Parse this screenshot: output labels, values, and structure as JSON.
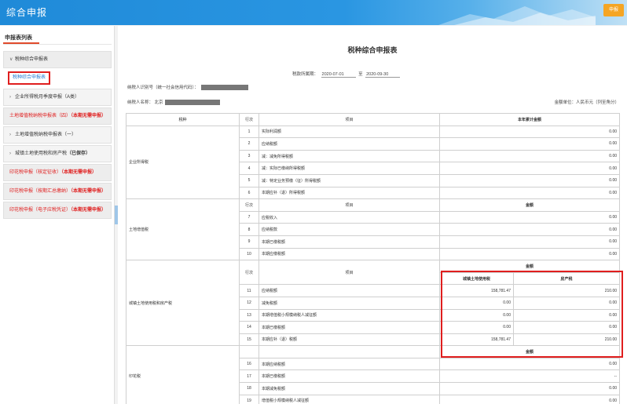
{
  "header": {
    "title": "综合申报",
    "declare_button": "申报"
  },
  "sidebar": {
    "tab_title": "申报表列表",
    "items": [
      {
        "label": "税种综合申报表",
        "chevron": "∨",
        "kind": "group"
      },
      {
        "label": "税种综合申报表",
        "kind": "selected-sub"
      },
      {
        "label": "企业所得税月季度申报（A类）",
        "chevron": "›",
        "kind": "group"
      },
      {
        "label": "土地增值税纳税申报表（四）",
        "suffix": "（本期无需申报）",
        "kind": "red"
      },
      {
        "label": "土地增值税纳税申报表（一）",
        "chevron": "›",
        "kind": "group"
      },
      {
        "label": "城镇土地使用税和房产税",
        "suffix": "（已保存）",
        "chevron": "›",
        "kind": "group-saved"
      },
      {
        "label": "印花税申报（核定征收）",
        "suffix": "（本期无需申报）",
        "kind": "red"
      },
      {
        "label": "印花税申报（按期汇总缴纳）",
        "suffix": "（本期无需申报）",
        "kind": "red"
      },
      {
        "label": "印花税申报（电子应税凭证）",
        "suffix": "（本期无需申报）",
        "kind": "red"
      }
    ]
  },
  "form": {
    "title": "税种综合申报表",
    "period_label": "税款所属期：",
    "period_start": "2020-07-01",
    "period_to": "至",
    "period_end": "2020-09-30",
    "taxid_label": "纳税人识别号（统一社会信用代码）：",
    "taxname_label": "纳税人名称：",
    "taxname_prefix": "北京",
    "unit_label": "金额单位：人民币元（列至角分）",
    "headers": {
      "tax_type": "税种",
      "line_no": "行次",
      "item": "项目",
      "ytd": "本年累计金额",
      "amount": "金额",
      "land_use": "城镇土地使用税",
      "property": "房产税"
    },
    "sections": {
      "cit": {
        "name": "企业所得税",
        "rows": [
          {
            "no": "1",
            "item": "实际利润额",
            "value": "0.00"
          },
          {
            "no": "2",
            "item": "应纳税额",
            "value": "0.00"
          },
          {
            "no": "3",
            "item": "减：减免所得税额",
            "value": "0.00"
          },
          {
            "no": "4",
            "item": "减：实际已缴纳所得税额",
            "value": "0.00"
          },
          {
            "no": "5",
            "item": "减：特定业务预缴（征）所得税额",
            "value": "0.00"
          },
          {
            "no": "6",
            "item": "本期应补（退）所得税额",
            "value": "0.00"
          }
        ]
      },
      "lvt": {
        "name": "土地增值税",
        "rows": [
          {
            "no": "7",
            "item": "应税收入",
            "value": "0.00"
          },
          {
            "no": "8",
            "item": "应纳税款",
            "value": "0.00"
          },
          {
            "no": "9",
            "item": "本期已缴税额",
            "value": "0.00"
          },
          {
            "no": "10",
            "item": "本期应缴税额",
            "value": "0.00"
          }
        ]
      },
      "land": {
        "name": "城镇土地使用税和房产税",
        "rows": [
          {
            "no": "11",
            "item": "应纳税额",
            "land": "158,781.47",
            "prop": "210.00"
          },
          {
            "no": "12",
            "item": "减免税额",
            "land": "0.00",
            "prop": "0.00"
          },
          {
            "no": "13",
            "item": "本期增值税小规模纳税人减征额",
            "land": "0.00",
            "prop": "0.00"
          },
          {
            "no": "14",
            "item": "本期已缴税额",
            "land": "0.00",
            "prop": "0.00"
          },
          {
            "no": "15",
            "item": "本期应补（退）税额",
            "land": "158,781.47",
            "prop": "210.00"
          }
        ]
      },
      "stamp": {
        "name": "印花税",
        "rows": [
          {
            "no": "16",
            "item": "本期应纳税额",
            "value": "0.00"
          },
          {
            "no": "17",
            "item": "本期已缴税额",
            "value": "--"
          },
          {
            "no": "18",
            "item": "本期减免税额",
            "value": "0.00"
          },
          {
            "no": "19",
            "item": "增值税小规模纳税人减征额",
            "value": "0.00"
          }
        ]
      }
    }
  }
}
